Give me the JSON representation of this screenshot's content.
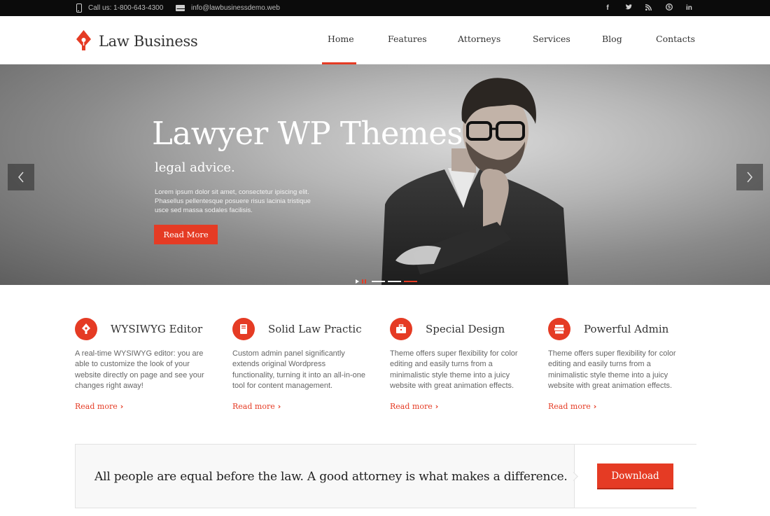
{
  "topbar": {
    "phone": "Call us: 1-800-643-4300",
    "email": "info@lawbusinessdemo.web",
    "social": [
      "f",
      "t",
      "rss",
      "s",
      "in"
    ]
  },
  "header": {
    "logo_text": "Law Business",
    "nav": [
      "Home",
      "Features",
      "Attorneys",
      "Services",
      "Blog",
      "Contacts"
    ],
    "active_nav": "Home"
  },
  "hero": {
    "title": "Lawyer WP Themes",
    "subtitle": "legal advice.",
    "text": "Lorem ipsum dolor sit amet, consectetur ipiscing elit. Phasellus pellentesque posuere risus lacinia tristique usce sed massa sodales facilisis.",
    "button": "Read More",
    "slide_count": 3,
    "active_slide": 3
  },
  "features": [
    {
      "icon": "pen-nib-icon",
      "title": "WYSIWYG Editor",
      "text": "A real-time WYSIWYG editor: you are able to customize the look of your website directly on page and see your changes right away!",
      "link": "Read more"
    },
    {
      "icon": "book-icon",
      "title": "Solid Law Practic",
      "text": "Custom admin panel significantly extends original Wordpress functionality, turning it into an all-in-one tool for content management.",
      "link": "Read more"
    },
    {
      "icon": "briefcase-icon",
      "title": "Special Design",
      "text": "Theme offers super flexibility for color editing and easily turns from a minimalistic style theme into a juicy website with great animation effects.",
      "link": "Read more"
    },
    {
      "icon": "books-stack-icon",
      "title": "Powerful Admin",
      "text": "Theme offers super flexibility for color editing and easily turns from a minimalistic style theme into a juicy website with great animation effects.",
      "link": "Read more"
    }
  ],
  "callout": {
    "text": "All people are equal before the law. A good attorney is what makes a difference.",
    "button": "Download"
  },
  "colors": {
    "accent": "#e53b24",
    "topbar": "#0b0b0b"
  }
}
